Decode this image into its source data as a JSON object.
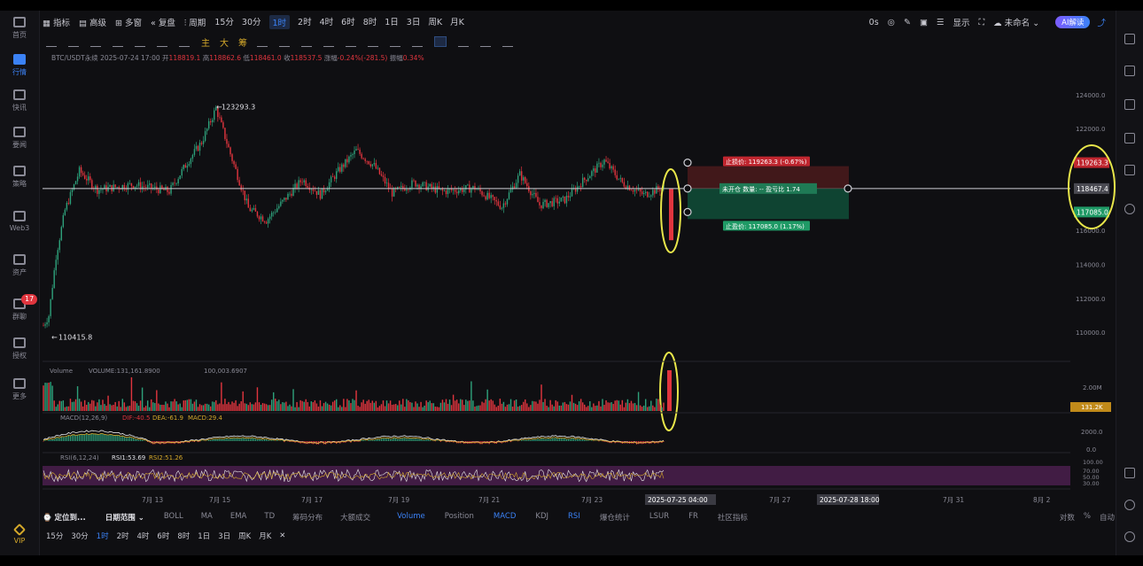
{
  "left_nav": [
    {
      "label": "首页",
      "icon": "home-icon"
    },
    {
      "label": "行情",
      "icon": "chart-bars-icon",
      "active": true
    },
    {
      "label": "快讯",
      "icon": "news-icon"
    },
    {
      "label": "要闻",
      "icon": "document-icon"
    },
    {
      "label": "策略",
      "icon": "strategy-icon"
    },
    {
      "label": "Web3",
      "icon": "globe-icon"
    },
    {
      "label": "资产",
      "icon": "wallet-icon"
    },
    {
      "label": "群聊",
      "icon": "chat-icon",
      "badge": "17"
    },
    {
      "label": "授权",
      "icon": "key-icon"
    },
    {
      "label": "更多",
      "icon": "grid-icon"
    },
    {
      "label": "VIP",
      "icon": "vip-icon"
    }
  ],
  "toolbar": {
    "indicators": "指标",
    "advanced": "高级",
    "multi": "多窗",
    "replay": "复盘",
    "period": "周期",
    "intervals": [
      "15分",
      "30分",
      "1时",
      "2时",
      "4时",
      "6时",
      "8时",
      "1日",
      "3日",
      "周K",
      "月K"
    ],
    "selected_interval": "1时",
    "right_items": [
      "0s",
      "显示",
      "未命名"
    ],
    "ai_label": "AI解读"
  },
  "drawing_tools": {
    "labels": [
      "主",
      "大",
      "筹"
    ]
  },
  "info": {
    "symbol": "BTC/USDT永续",
    "time": "2025-07-24 17:00",
    "open_label": "开",
    "open": "118819.1",
    "high_label": "高",
    "high": "118862.6",
    "low_label": "低",
    "low": "118461.0",
    "close_label": "收",
    "close": "118537.5",
    "change_label": "涨幅",
    "change": "-0.24%(-281.5)",
    "amp_label": "振幅",
    "amp": "0.34%"
  },
  "chart_data": {
    "type": "candlestick",
    "symbol": "BTC/USDT",
    "ylim": [
      108500,
      125500
    ],
    "y_ticks": [
      "124000.0",
      "122000.0",
      "120000.0",
      "116000.0",
      "114000.0",
      "112000.0",
      "110000.0"
    ],
    "x_ticks": [
      "7月 13",
      "7月 15",
      "7月 17",
      "7月 19",
      "7月 21",
      "7月 23",
      "7月 27",
      "7月 31",
      "8月 2"
    ],
    "x_highlight_1": "2025-07-25 04:00",
    "x_highlight_2": "2025-07-28 18:00",
    "high_label": "123293.3",
    "low_label": "110415.8",
    "current_price": 118467.4,
    "stop_loss_label": "止损价: 119263.3 (-0.67%)",
    "take_profit_label": "止盈价: 117085.0 (1.17%)",
    "position_label": "未开仓  数量: --  盈亏比 1.74",
    "price_tags": [
      "119263.3",
      "118467.4",
      "117085.0"
    ],
    "price_tag_values": [
      119263.3,
      118467.4,
      117085.0
    ],
    "volume": {
      "title": "Volume",
      "text": "VOLUME:131,161.8900",
      "ma_text": "100,003.6907",
      "ytick": "2.00M",
      "current": "131.2K"
    },
    "macd": {
      "title": "MACD(12,26,9)",
      "dif": "DIF:-40.5",
      "dea": "DEA:-61.9",
      "macd": "MACD:29.4",
      "yticks": [
        "2000.0",
        "0.0"
      ]
    },
    "rsi": {
      "title": "RSI(6,12,24)",
      "rsi1": "RSI1:53.69",
      "rsi2": "RSI2:51.26",
      "yticks": [
        "100.00",
        "70.00",
        "50.00",
        "30.00"
      ]
    }
  },
  "bottom_bar": {
    "locate": "定位到...",
    "date_range": "日期范围",
    "indicators": [
      "BOLL",
      "MA",
      "EMA",
      "TD",
      "筹码分布",
      "大额成交"
    ],
    "sub_indicators": [
      "Volume",
      "Position",
      "MACD",
      "KDJ",
      "RSI",
      "爆仓统计",
      "LSUR",
      "FR",
      "社区指标"
    ],
    "active_sub": [
      "Volume",
      "MACD",
      "RSI"
    ],
    "right": [
      "对数",
      "%",
      "自动"
    ],
    "intervals": [
      "15分",
      "30分",
      "1时",
      "2时",
      "4时",
      "6时",
      "8时",
      "1日",
      "3日",
      "周K",
      "月K"
    ],
    "selected_interval": "1时"
  },
  "colors": {
    "up": "#2ea07a",
    "down": "#e0353e",
    "accent": "#3b82f6",
    "highlight": "#e8e64a"
  }
}
